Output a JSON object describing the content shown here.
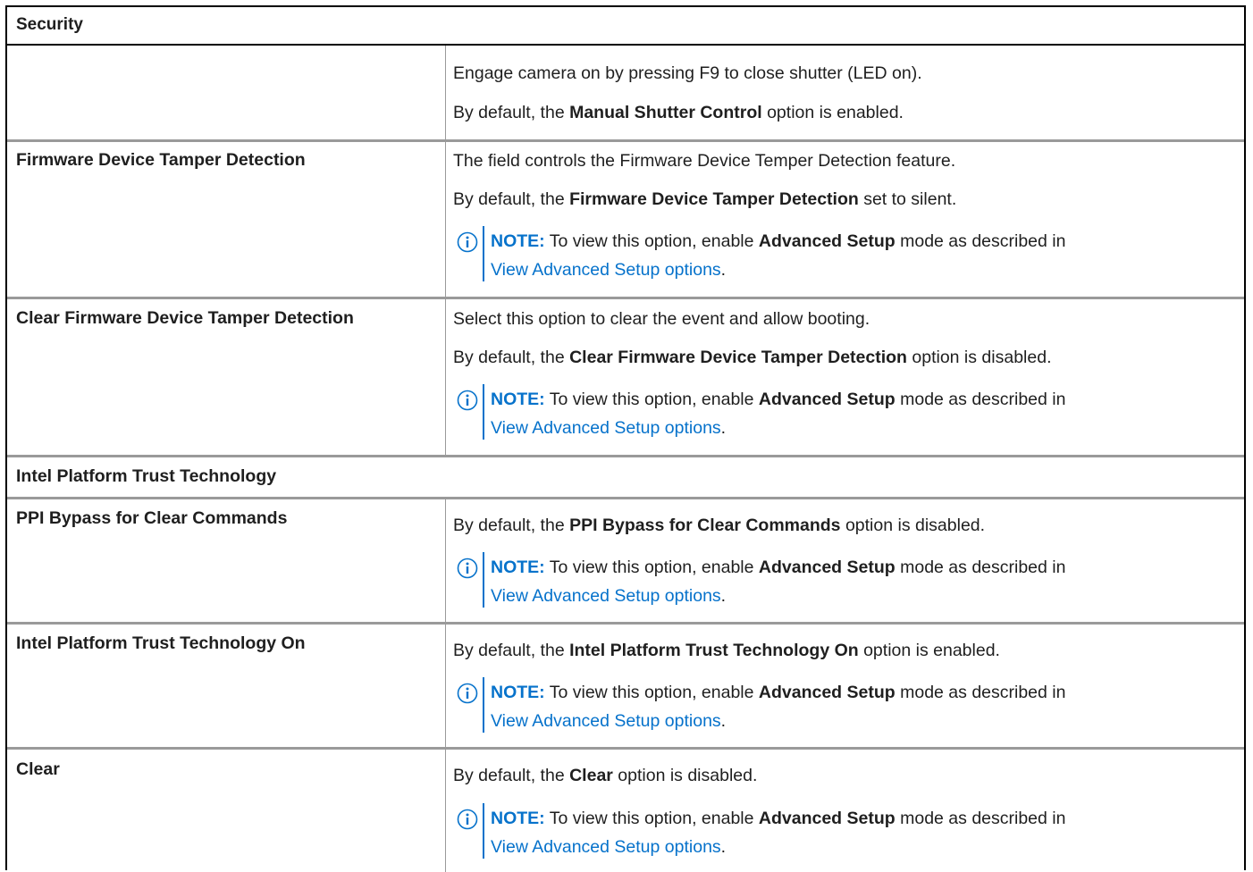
{
  "section": {
    "title": "Security"
  },
  "rows": {
    "manual_shutter": {
      "line1": "Engage camera on by pressing F9 to close shutter (LED on).",
      "line2_pre": "By default, the ",
      "line2_bold": "Manual Shutter Control",
      "line2_post": " option is enabled."
    },
    "fw_tamper": {
      "label": "Firmware Device Tamper Detection",
      "line1": "The field controls the Firmware Device Temper Detection feature.",
      "line2_pre": "By default, the ",
      "line2_bold": "Firmware Device Tamper Detection",
      "line2_post": " set to silent."
    },
    "clear_fw_tamper": {
      "label": "Clear Firmware Device Tamper Detection",
      "line1": "Select this option to clear the event and allow booting.",
      "line2_pre": "By default, the ",
      "line2_bold": "Clear Firmware Device Tamper Detection",
      "line2_post": " option is disabled."
    },
    "intel_ptt_heading": {
      "label": "Intel Platform Trust Technology"
    },
    "ppi_bypass": {
      "label": "PPI Bypass for Clear Commands",
      "line1_pre": "By default, the ",
      "line1_bold": "PPI Bypass for Clear Commands",
      "line1_post": " option is disabled."
    },
    "intel_ptt_on": {
      "label": "Intel Platform Trust Technology On",
      "line1_pre": "By default, the ",
      "line1_bold": "Intel Platform Trust Technology On",
      "line1_post": " option is enabled."
    },
    "clear": {
      "label": "Clear",
      "line1_pre": "By default, the ",
      "line1_bold": "Clear",
      "line1_post": " option is disabled."
    }
  },
  "note": {
    "label": "NOTE:",
    "text_pre": " To view this option, enable ",
    "text_bold": "Advanced Setup",
    "text_post": " mode as described in",
    "link_text": "View Advanced Setup options",
    "link_suffix": "."
  },
  "colors": {
    "accent": "#0672cb",
    "rule": "#9a9a9a",
    "border": "#000000"
  },
  "icons": {
    "note": "info-circle-icon"
  }
}
